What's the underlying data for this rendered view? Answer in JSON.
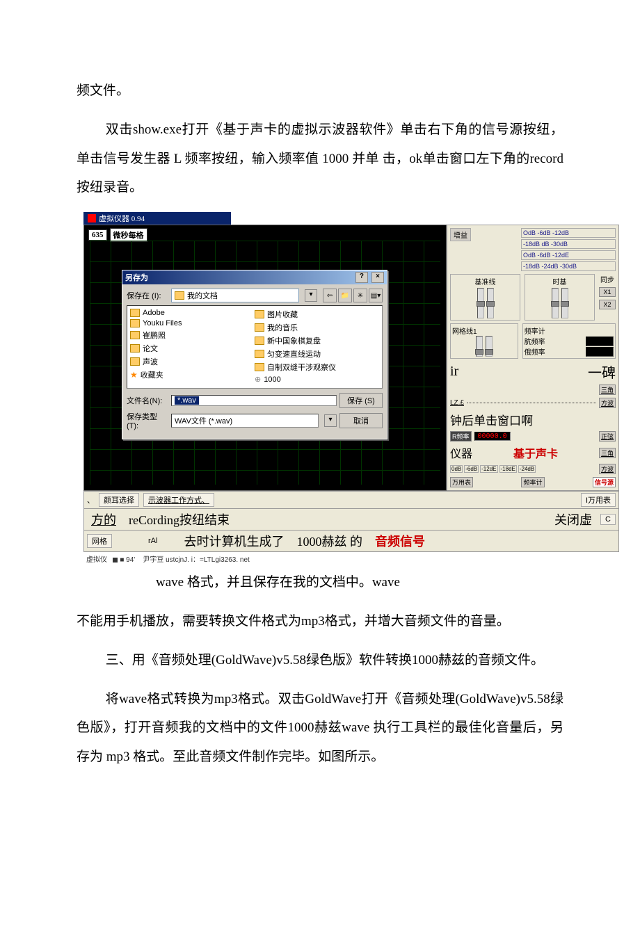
{
  "paragraphs": {
    "p1": "频文件。",
    "p2": "双击show.exe打开《基于声卡的虚拟示波器软件》单击右下角的信号源按纽，单击信号发生器 L 频率按纽，输入频率值 1000 并单 击，ok单击窗口左下角的record按纽录音。",
    "p3a_prefix": "wave 格式，并且保存在我的文档中。wave",
    "p3b": "不能用手机播放，需要转换文件格式为mp3格式，并增大音频文件的音量。",
    "p4": "三、用《音频处理(GoldWave)v5.58绿色版》软件转换1000赫兹的音频文件。",
    "p5": "将wave格式转换为mp3格式。双击GoldWave打开《音频处理(GoldWave)v5.58绿色版》，打开音频我的文档中的文件1000赫兹wave 执行工具栏的最佳化音量后，另存为 mp3 格式。至此音频文件制作完毕。如图所示。"
  },
  "app": {
    "title": "虚拟仪器 0.94",
    "scope_label_num": "635",
    "scope_label_txt": "微秒每格"
  },
  "dialog": {
    "title": "另存为",
    "help_btn": "?",
    "close_btn": "×",
    "save_in_label": "保存在 (I):",
    "save_in_value": "我的文档",
    "left_files": [
      "Adobe",
      "Youku Files",
      "崔鹏照",
      "论文",
      "声波",
      "收藏夹"
    ],
    "right_files": [
      "图片收藏",
      "我的音乐",
      "新中国象棋复盘",
      "匀变速直线运动",
      "自制双缝干涉观察仪",
      "1000"
    ],
    "filename_label": "文件名(N):",
    "filename_value": "*.wav",
    "filetype_label": "保存类型 (T):",
    "filetype_value": "WAV文件 (*.wav)",
    "save_btn": "保存 (S)",
    "cancel_btn": "取消"
  },
  "panel": {
    "gain_title": "增益",
    "db_rows": [
      "OdB -6dB -12dB",
      "-18dB dB -30dB",
      "OdB -6dB -12dE",
      "-18dB -24dB -30dB"
    ],
    "baseline": "基准线",
    "timebase": "时基",
    "sync": "同步",
    "x1": "X1",
    "x2": "X2",
    "gridline1": "网格线1",
    "freqmeter": "频率计",
    "hfreq": "肮频率",
    "efreq": "俄频率",
    "ir": "ir",
    "bei": "一碑",
    "triangle": "三角",
    "square_wave": "方波",
    "lze": "LZ.£",
    "overlay_line": "钟后单击窗口啊",
    "r_btn": "R频率",
    "overlay_line2_a": "仪器",
    "overlay_line2_b": "基于声卡",
    "zhengxian": "正弦",
    "db_nums": [
      "0dB",
      "-6dB",
      "-12dE",
      "-18dE",
      "-24dB"
    ],
    "wan_btn": "万用表",
    "freq_btn": "频率计",
    "sig_btn": "信号源"
  },
  "bottom": {
    "ear_select": "颜耳选择",
    "scope_mode": "示波器工作方式、",
    "wan_table": "I万用表",
    "fang_de": "方的",
    "recording_text": "reCording按纽结束",
    "close_virtual": "关闭虚",
    "c": "C",
    "grid": "网格",
    "rai": "rAl",
    "gen_text_a": "去时计算机生成了",
    "gen_text_b": "1000赫兹 的",
    "gen_text_c": "音频信号",
    "virtual": "虚拟仪",
    "dot94": "■ 94'",
    "author": "尹宇豆 ustcjnJ. i：=LTLgi3263. net"
  }
}
